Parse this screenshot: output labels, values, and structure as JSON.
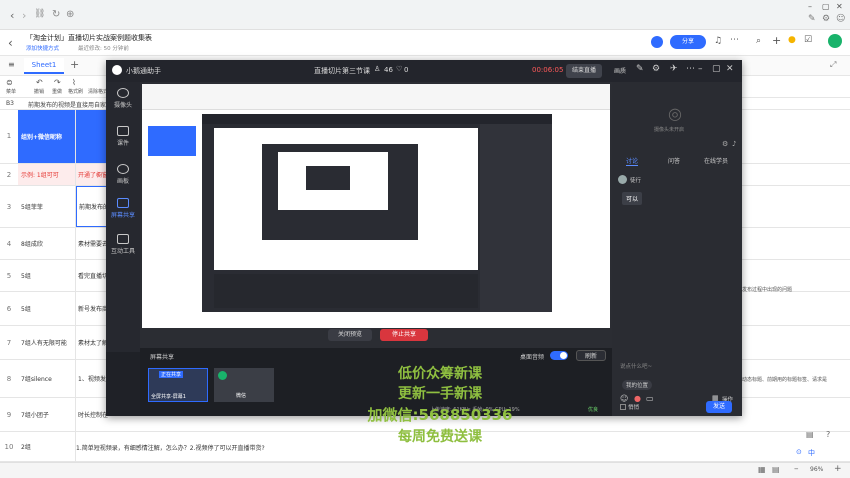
{
  "browser": {
    "window_controls": [
      "–",
      "▢",
      "✕"
    ]
  },
  "doc": {
    "title": "「淘金计划」直播切片实战案例题收集表",
    "subtitle_link": "添加快捷方式",
    "last_modified": "最近修改: 50 分钟前",
    "share_label": "分享"
  },
  "sheet_tabs": [
    {
      "label": "Sheet1"
    }
  ],
  "toolbar": {
    "items": [
      "菜单",
      "撤销",
      "重做",
      "格式刷",
      "清除格式"
    ]
  },
  "formula": {
    "cell_ref": "B3",
    "content": "前期发布的视频是直接用自家直播间"
  },
  "grid": {
    "rows": [
      {
        "num": "1",
        "a": "组别+微信昵称",
        "b": ""
      },
      {
        "num": "2",
        "a": "示例: 1组可可",
        "b": "开通了橱窗"
      },
      {
        "num": "3",
        "a": "5组菲菲",
        "b": "前期发布的"
      },
      {
        "num": "4",
        "a": "8组成欣",
        "b": "素材需要去"
      },
      {
        "num": "5",
        "a": "5组",
        "b": "看完直播切片"
      },
      {
        "num": "6",
        "a": "5组",
        "b": "新号发布商"
      },
      {
        "num": "7",
        "a": "7组人有无限可能",
        "b": "素材太了解"
      },
      {
        "num": "8",
        "a": "7组silence",
        "b": "1、视频发布"
      },
      {
        "num": "9",
        "a": "7组小团子",
        "b": "时长控制在"
      },
      {
        "num": "10",
        "a": "2组",
        "b": "1.简单短视频录，有细感情注解，怎么办？2.视频停了可以开直播带货?"
      }
    ],
    "right_col_text": [
      "发布过程中出现的问题",
      "动态标题、前期用的标题标签、请求是"
    ]
  },
  "status": {
    "zoom": "96%",
    "lang": "中"
  },
  "video": {
    "app_name": "小鹅通助手",
    "live_title": "直播切片第三节课",
    "viewers": "46",
    "likes": "0",
    "timer": "00:06:05",
    "end_live_label": "结束直播",
    "quality_label": "画质",
    "side_buttons": [
      "摄像头",
      "课件",
      "画板",
      "屏幕共享",
      "互动工具"
    ],
    "stop_preview": "关闭预览",
    "stop_share": "停止共享",
    "share_panel_title": "屏幕共享",
    "desktop_audio": "桌面音频",
    "refresh": "刷新",
    "thumb_sharing": "正在共享",
    "thumb1_label": "全屏共享-屏幕1",
    "thumb2_label": "微信",
    "stats": "上传速度: 61KB/s   丢帧: 0%   CPU: 19%",
    "stats_quality": "优良",
    "camera_placeholder": "摄像头未开启",
    "tabs": [
      "讨论",
      "问答",
      "在线学员"
    ],
    "chat_user": "徒行",
    "chat_msg": "可以",
    "my_position": "我的位置",
    "operate": "操作",
    "input_placeholder": "说点什么吧~",
    "private_label": "悄悄",
    "send_label": "发送"
  },
  "watermark": {
    "line1": "低价众筹新课",
    "line2": "更新一手新课",
    "line3": "加微信:568850336",
    "line4": "每周免费送课"
  },
  "colors": {
    "accent": "#2f6bff",
    "red": "#d9363e",
    "watermark": "#8fbf40"
  }
}
